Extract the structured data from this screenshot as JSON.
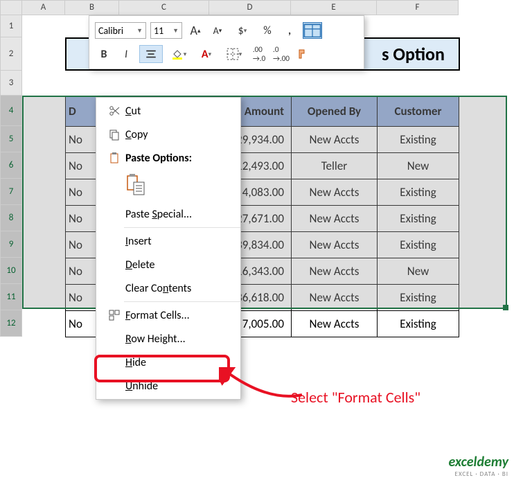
{
  "columns": [
    "A",
    "B",
    "C",
    "D",
    "E",
    "F"
  ],
  "rows": [
    "1",
    "2",
    "3",
    "4",
    "5",
    "6",
    "7",
    "8",
    "9",
    "10",
    "11",
    "12"
  ],
  "mini_toolbar": {
    "font": "Calibri",
    "size": "11",
    "increase_font": "A",
    "decrease_font": "A",
    "currency": "$",
    "percent": "%",
    "comma": ","
  },
  "title": "s Option",
  "table": {
    "headers": {
      "date": "D",
      "amount": "Amount",
      "opened_by": "Opened By",
      "customer": "Customer"
    },
    "rows": [
      {
        "date": "No",
        "amount": "29,934.00",
        "opened_by": "New Accts",
        "customer": "Existing"
      },
      {
        "date": "No",
        "amount": "12,493.00",
        "opened_by": "Teller",
        "customer": "New"
      },
      {
        "date": "No",
        "amount": "4,083.00",
        "opened_by": "New Accts",
        "customer": "Existing"
      },
      {
        "date": "No",
        "amount": "27,671.00",
        "opened_by": "New Accts",
        "customer": "Existing"
      },
      {
        "date": "No",
        "amount": "39,834.00",
        "opened_by": "New Accts",
        "customer": "Existing"
      },
      {
        "date": "No",
        "amount": "16,343.00",
        "opened_by": "New Accts",
        "customer": "New"
      },
      {
        "date": "No",
        "amount": "36,618.00",
        "opened_by": "New Accts",
        "customer": "Existing"
      },
      {
        "date": "No",
        "amount": "7,005.00",
        "opened_by": "New Accts",
        "customer": "Existing"
      }
    ]
  },
  "context_menu": {
    "cut": "Cut",
    "copy": "Copy",
    "paste_options": "Paste Options:",
    "paste_special": "Paste Special...",
    "insert": "Insert",
    "delete": "Delete",
    "clear_contents": "Clear Contents",
    "format_cells": "Format Cells...",
    "row_height": "Row Height...",
    "hide": "Hide",
    "unhide": "Unhide"
  },
  "annotation": "Select \"Format Cells\"",
  "watermark": {
    "main": "exceldemy",
    "sub": "EXCEL · DATA · BI"
  }
}
